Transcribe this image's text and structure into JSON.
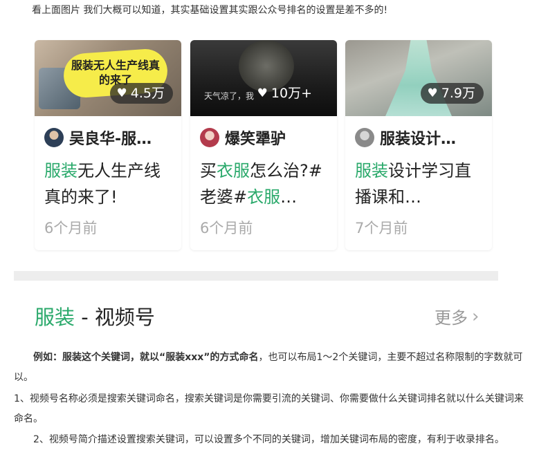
{
  "intro": "看上面图片 我们大概可以知道，其实基础设置其实跟公众号排名的设置是差不多的!",
  "cards": [
    {
      "thumb_text": "服装无人生产线真的来了",
      "likes": "4.5万",
      "author": "吴良华-服…",
      "title_hl": "服装",
      "title_rest": "无人生产线真的来了!",
      "time": "6个月前"
    },
    {
      "thumb_caption": "天气凉了，我",
      "likes": "10万+",
      "author": "爆笑犟驴",
      "title_pre": "买",
      "title_hl": "衣服",
      "title_mid": "怎么治?#老婆#",
      "title_hl2": "衣服",
      "title_end": "…",
      "time": "6个月前"
    },
    {
      "likes": "7.9万",
      "author": "服装设计…",
      "title_hl": "服装",
      "title_rest": "设计学习直播课和…",
      "time": "7个月前"
    }
  ],
  "section": {
    "title_hl": "服装",
    "title_rest": " - 视频号",
    "more": "更多"
  },
  "paragraphs": {
    "p1_bold": "例如：服装这个关键词，就以“服装xxx”的方式命名",
    "p1_rest": "，也可以布局1～2个关键词，主要不超过名称限制的字数就可以。",
    "p2": "1、视频号名称必须是搜索关键词命名，搜索关键词是你需要引流的关键词、你需要做什么关键词排名就以什么关键词来命名。",
    "p3": "2、视频号简介描述设置搜索关键词，可以设置多个不同的关键词，增加关键词布局的密度，有利于收录排名。"
  },
  "colors": {
    "accent": "#2aa96b",
    "muted": "#aaaaaa"
  },
  "icons": {
    "likes": "heart-icon",
    "more": "chevron-right-icon"
  }
}
